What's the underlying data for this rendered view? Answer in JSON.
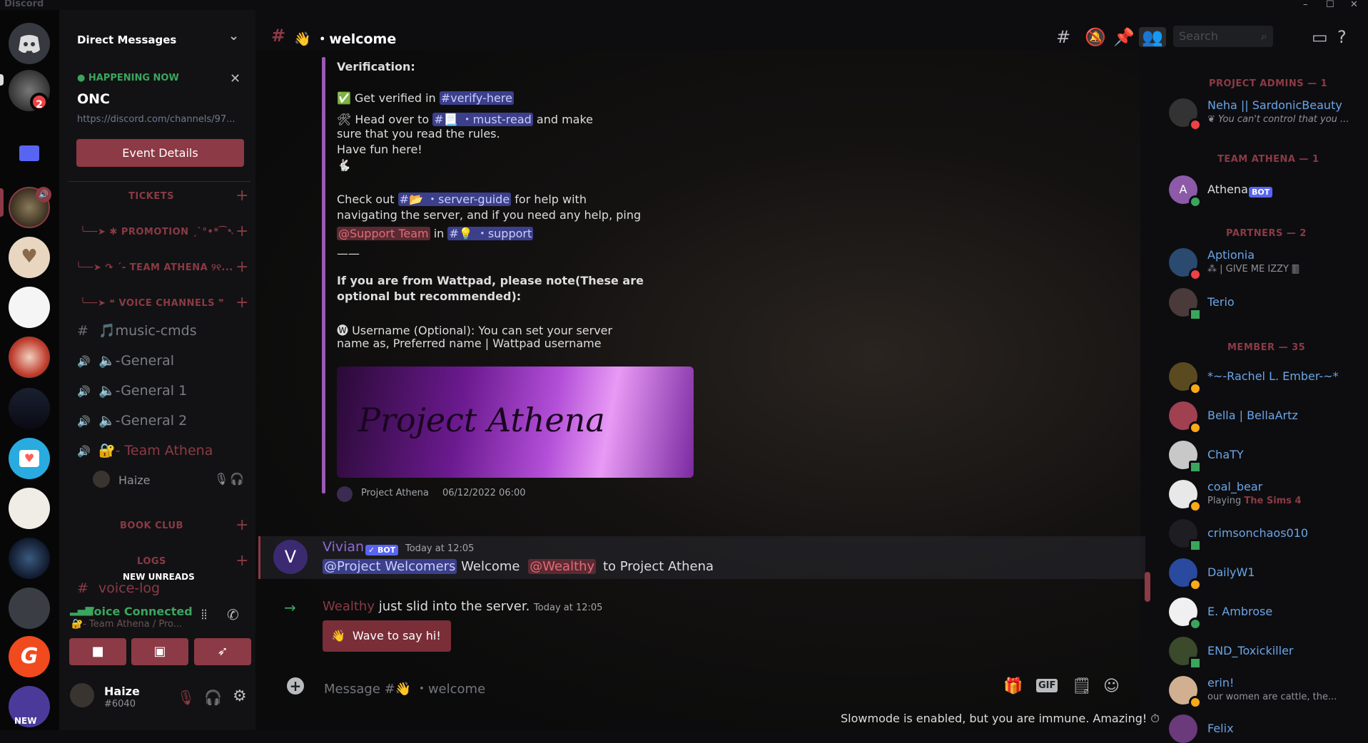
{
  "app": {
    "brand": "Discord"
  },
  "window": {
    "minimize": "–",
    "maximize": "☐",
    "close": "✕"
  },
  "rail": {
    "unread_badge": "2",
    "new_label": "NEW"
  },
  "sidebar": {
    "header": "Direct Messages",
    "event": {
      "status": "● HAPPENING NOW",
      "title": "ONC",
      "link": "https://discord.com/channels/97...",
      "button": "Event Details"
    },
    "categories": [
      {
        "label": "TICKETS"
      },
      {
        "label": "╰──➤ ✱ PROMOTION ˏˋ°•*⁀➷"
      },
      {
        "label": "╰──➤ ↷ ˊ- TEAM ATHENA ୨୧..."
      },
      {
        "label": "╰──➤ ❝ VOICE CHANNELS ❞"
      },
      {
        "label": "BOOK CLUB"
      },
      {
        "label": "LOGS"
      }
    ],
    "channels": [
      {
        "icon": "#",
        "label": "🎵music-cmds"
      },
      {
        "icon": "🔊",
        "label": "🔈-General"
      },
      {
        "icon": "🔊",
        "label": "🔈-General 1"
      },
      {
        "icon": "🔊",
        "label": "🔈-General 2"
      },
      {
        "icon": "🔊",
        "label": "🔐- Team Athena"
      },
      {
        "icon": "#",
        "label": "voice-log"
      }
    ],
    "voice_member": "Haize",
    "new_unreads": "NEW UNREADS",
    "voice": {
      "status": "Voice Connected",
      "location": "🔐- Team Athena / Pro..."
    },
    "user": {
      "name": "Haize",
      "tag": "#6040"
    }
  },
  "chat": {
    "channel_name": "👋 ・welcome",
    "search_placeholder": "Search",
    "embed": {
      "heading": "Verification:",
      "line1_pre": "✅ Get verified in",
      "line1_mention": "#verify-here",
      "line2_pre": "🛠 Head over to",
      "line2_mention": "#📃 ・must-read",
      "line2_post": "and make",
      "line3": "sure that you read the rules.",
      "line4": "Have fun here!",
      "line5": "🐇",
      "line6_pre": "Check out",
      "line6_mention": "#📂 ・server-guide",
      "line6_post": "for help with",
      "line7": "navigating the server, and if you need any help, ping",
      "line8_role": "@Support Team",
      "line8_mid": "in",
      "line8_mention": "#💡 ・support",
      "line9": "——",
      "wattpad1": "If you are from Wattpad, please note(These are",
      "wattpad2": "optional but recommended):",
      "wattpad3": "🅦 Username (Optional): You can set your server",
      "wattpad4": "name as, Preferred name | Wattpad username",
      "banner_text": "Project Athena",
      "footer_author": "Project Athena",
      "footer_date": "06/12/2022 06:00"
    },
    "message": {
      "author": "Vivian",
      "bot_badge": "✓ BOT",
      "time": "Today at 12:05",
      "role_mention": "@Project Welcomers",
      "text1": "Welcome",
      "user_mention": "@Wealthy",
      "text2": "to Project Athena"
    },
    "join": {
      "user": "Wealthy",
      "text": "just slid into the server.",
      "time": "Today at 12:05",
      "button": "Wave to say hi!"
    },
    "input_placeholder": "Message #👋 ・welcome",
    "slowmode": "Slowmode is enabled, but you are immune. Amazing! ⏱"
  },
  "members": {
    "groups": [
      {
        "header": "PROJECT ADMINS — 1",
        "items": [
          {
            "name": "Neha || SardonicBeauty",
            "sub": "❦ You can't control that you ...",
            "color": "#6aa5e6"
          }
        ]
      },
      {
        "header": "TEAM ATHENA — 1",
        "items": [
          {
            "name": "Athena",
            "badge": "BOT",
            "color": "#dcddde"
          }
        ]
      },
      {
        "header": "PARTNERS — 2",
        "items": [
          {
            "name": "Aptionia",
            "sub": "⁂ | GIVE ME IZZY 🀫",
            "color": "#6aa5e6"
          },
          {
            "name": "Terio",
            "color": "#6aa5e6"
          }
        ]
      },
      {
        "header": "MEMBER — 35",
        "items": [
          {
            "name": "*~-Rachel L. Ember-~*",
            "color": "#6aa5e6"
          },
          {
            "name": "Bella | BellaArtz",
            "color": "#6aa5e6"
          },
          {
            "name": "ChaTY",
            "color": "#6aa5e6"
          },
          {
            "name": "coal_bear",
            "sub_pre": "Playing",
            "sub_bold": "The Sims 4",
            "color": "#6aa5e6"
          },
          {
            "name": "crimsonchaos010",
            "color": "#6aa5e6"
          },
          {
            "name": "DailyW1",
            "color": "#6aa5e6"
          },
          {
            "name": "E. Ambrose",
            "color": "#6aa5e6"
          },
          {
            "name": "END_Toxickiller",
            "color": "#6aa5e6"
          },
          {
            "name": "erin!",
            "sub": "our women are cattle, the...",
            "color": "#6aa5e6"
          },
          {
            "name": "Felix",
            "color": "#6aa5e6"
          }
        ]
      }
    ]
  },
  "colors": {
    "accent": "#8c3a45",
    "online": "#3ba55d",
    "dnd": "#ed4245",
    "idle": "#faa81a",
    "mention_bg": "#3c3f8a"
  }
}
